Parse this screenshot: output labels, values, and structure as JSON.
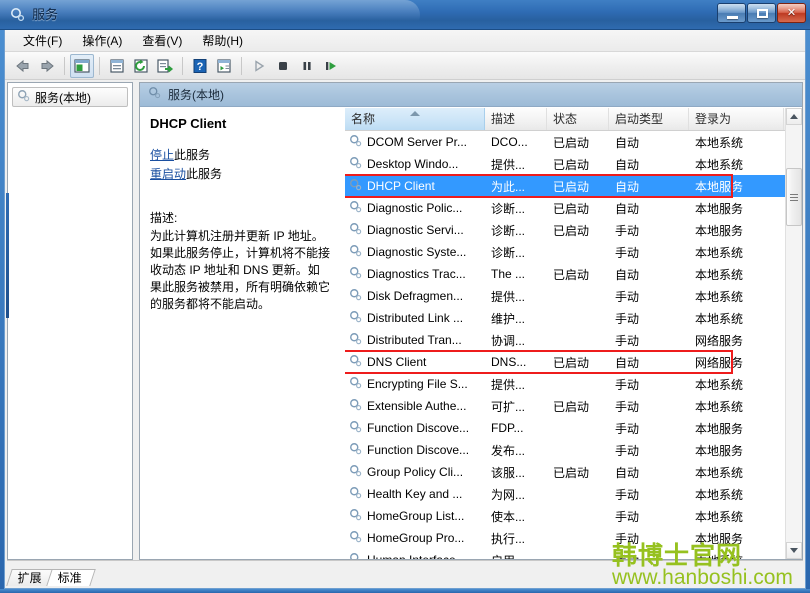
{
  "window": {
    "title": "服务",
    "title_icon": "services-gear-icon",
    "buttons": {
      "minimize": "最小化",
      "maximize": "最大化",
      "close": "关闭"
    }
  },
  "menubar": [
    {
      "label": "文件(F)",
      "name": "menu-file"
    },
    {
      "label": "操作(A)",
      "name": "menu-action"
    },
    {
      "label": "查看(V)",
      "name": "menu-view"
    },
    {
      "label": "帮助(H)",
      "name": "menu-help"
    }
  ],
  "toolbar": [
    {
      "icon": "back-arrow-icon",
      "tip": "后退"
    },
    {
      "icon": "forward-arrow-icon",
      "tip": "前进"
    },
    {
      "icon": "show-console-tree-icon",
      "tip": "显示/隐藏控制台树"
    },
    {
      "icon": "properties-icon",
      "tip": "属性"
    },
    {
      "icon": "refresh-icon",
      "tip": "刷新"
    },
    {
      "icon": "export-list-icon",
      "tip": "导出列表"
    },
    {
      "icon": "help-icon",
      "tip": "帮助"
    },
    {
      "icon": "show-action-pane-icon",
      "tip": "显示操作窗格"
    },
    {
      "icon": "start-service-icon",
      "tip": "启动服务"
    },
    {
      "icon": "stop-service-icon",
      "tip": "停止服务"
    },
    {
      "icon": "pause-service-icon",
      "tip": "暂停服务"
    },
    {
      "icon": "restart-service-icon",
      "tip": "重启动服务"
    }
  ],
  "left_pane": {
    "tree_item": "服务(本地)",
    "tree_icon": "services-gear-icon"
  },
  "right_pane": {
    "header": "服务(本地)",
    "header_icon": "services-gear-icon"
  },
  "detail": {
    "service_name": "DHCP Client",
    "stop_link": "停止",
    "stop_suffix": "此服务",
    "restart_link": "重启动",
    "restart_suffix": "此服务",
    "description_label": "描述:",
    "description_body": "为此计算机注册并更新 IP 地址。如果此服务停止，计算机将不能接收动态 IP 地址和 DNS 更新。如果此服务被禁用，所有明确依赖它的服务都将不能启动。"
  },
  "list": {
    "columns": [
      {
        "label": "名称",
        "width": 140,
        "sorted": true,
        "sort_dir": "asc"
      },
      {
        "label": "描述",
        "width": 62,
        "sorted": false
      },
      {
        "label": "状态",
        "width": 62,
        "sorted": false
      },
      {
        "label": "启动类型",
        "width": 80,
        "sorted": false
      },
      {
        "label": "登录为",
        "width": 95,
        "sorted": false
      }
    ],
    "rows": [
      {
        "icon": "service-gear-icon",
        "name": "DCOM Server Pr...",
        "desc": "DCO...",
        "status": "已启动",
        "startup": "自动",
        "logon": "本地系统",
        "selected": false
      },
      {
        "icon": "service-gear-icon",
        "name": "Desktop Windo...",
        "desc": "提供...",
        "status": "已启动",
        "startup": "自动",
        "logon": "本地系统",
        "selected": false
      },
      {
        "icon": "service-gear-icon",
        "name": "DHCP Client",
        "desc": "为此...",
        "status": "已启动",
        "startup": "自动",
        "logon": "本地服务",
        "selected": true
      },
      {
        "icon": "service-gear-icon",
        "name": "Diagnostic Polic...",
        "desc": "诊断...",
        "status": "已启动",
        "startup": "自动",
        "logon": "本地服务",
        "selected": false
      },
      {
        "icon": "service-gear-icon",
        "name": "Diagnostic Servi...",
        "desc": "诊断...",
        "status": "已启动",
        "startup": "手动",
        "logon": "本地服务",
        "selected": false
      },
      {
        "icon": "service-gear-icon",
        "name": "Diagnostic Syste...",
        "desc": "诊断...",
        "status": "",
        "startup": "手动",
        "logon": "本地系统",
        "selected": false
      },
      {
        "icon": "service-gear-icon",
        "name": "Diagnostics Trac...",
        "desc": "The ...",
        "status": "已启动",
        "startup": "自动",
        "logon": "本地系统",
        "selected": false
      },
      {
        "icon": "service-gear-icon",
        "name": "Disk Defragmen...",
        "desc": "提供...",
        "status": "",
        "startup": "手动",
        "logon": "本地系统",
        "selected": false
      },
      {
        "icon": "service-gear-icon",
        "name": "Distributed Link ...",
        "desc": "维护...",
        "status": "",
        "startup": "手动",
        "logon": "本地系统",
        "selected": false
      },
      {
        "icon": "service-gear-icon",
        "name": "Distributed Tran...",
        "desc": "协调...",
        "status": "",
        "startup": "手动",
        "logon": "网络服务",
        "selected": false
      },
      {
        "icon": "service-gear-icon",
        "name": "DNS Client",
        "desc": "DNS...",
        "status": "已启动",
        "startup": "自动",
        "logon": "网络服务",
        "selected": false
      },
      {
        "icon": "service-gear-icon",
        "name": "Encrypting File S...",
        "desc": "提供...",
        "status": "",
        "startup": "手动",
        "logon": "本地系统",
        "selected": false
      },
      {
        "icon": "service-gear-icon",
        "name": "Extensible Authe...",
        "desc": "可扩...",
        "status": "已启动",
        "startup": "手动",
        "logon": "本地系统",
        "selected": false
      },
      {
        "icon": "service-gear-icon",
        "name": "Function Discove...",
        "desc": "FDP...",
        "status": "",
        "startup": "手动",
        "logon": "本地服务",
        "selected": false
      },
      {
        "icon": "service-gear-icon",
        "name": "Function Discove...",
        "desc": "发布...",
        "status": "",
        "startup": "手动",
        "logon": "本地服务",
        "selected": false
      },
      {
        "icon": "service-gear-icon",
        "name": "Group Policy Cli...",
        "desc": "该服...",
        "status": "已启动",
        "startup": "自动",
        "logon": "本地系统",
        "selected": false
      },
      {
        "icon": "service-gear-icon",
        "name": "Health Key and ...",
        "desc": "为网...",
        "status": "",
        "startup": "手动",
        "logon": "本地系统",
        "selected": false
      },
      {
        "icon": "service-gear-icon",
        "name": "HomeGroup List...",
        "desc": "使本...",
        "status": "",
        "startup": "手动",
        "logon": "本地系统",
        "selected": false
      },
      {
        "icon": "service-gear-icon",
        "name": "HomeGroup Pro...",
        "desc": "执行...",
        "status": "",
        "startup": "手动",
        "logon": "本地服务",
        "selected": false
      },
      {
        "icon": "service-gear-icon",
        "name": "Human Interface",
        "desc": "启用",
        "status": "",
        "startup": "手动",
        "logon": "本地系统",
        "selected": false
      }
    ],
    "highlight_rows": [
      2,
      10
    ]
  },
  "tabs": [
    {
      "label": "扩展",
      "active": false
    },
    {
      "label": "标准",
      "active": true
    }
  ],
  "watermark": {
    "line1": "韩博士官网",
    "line2": "www.hanboshi.com",
    "color": "#96c11f"
  },
  "colors": {
    "selection": "#3399ff",
    "annotation": "#ee1c1c",
    "link": "#1a4fa0",
    "titlebar": "#2f6cb4"
  }
}
